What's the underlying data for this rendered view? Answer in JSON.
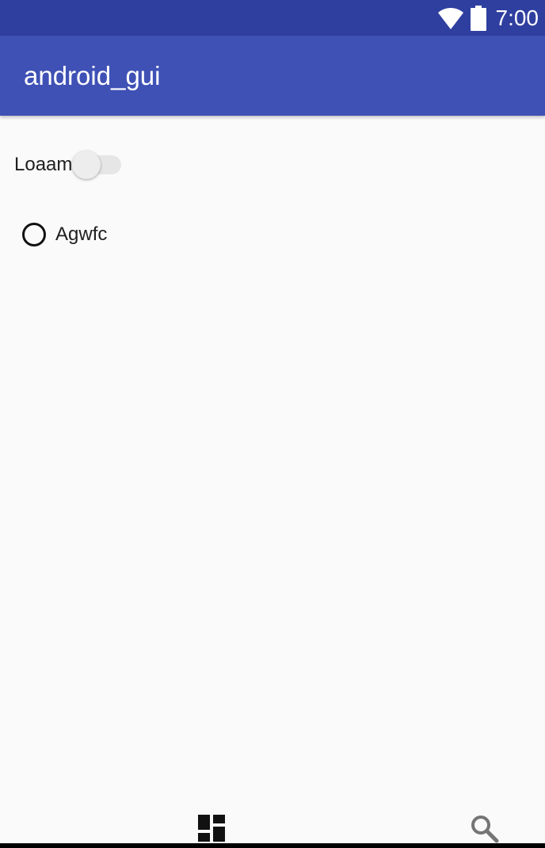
{
  "status_bar": {
    "time": "7:00",
    "icons": [
      "wifi-icon",
      "battery-icon"
    ]
  },
  "app_bar": {
    "title": "android_gui",
    "color": "#3f51b5"
  },
  "content": {
    "switch": {
      "label": "Loaam",
      "state": "off"
    },
    "radio": {
      "label": "Agwfc",
      "selected": false
    }
  },
  "bottom_nav": {
    "items": [
      "dashboard-icon",
      "search-icon"
    ]
  },
  "colors": {
    "status_bar": "#2f3f9f",
    "background": "#fafafa"
  }
}
